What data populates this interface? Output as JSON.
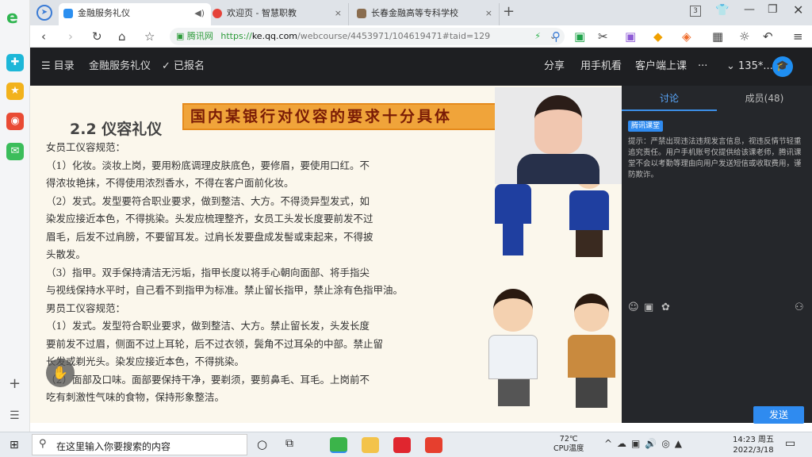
{
  "tabs": [
    {
      "title": "金融服务礼仪",
      "close": "◀)"
    },
    {
      "title": "欢迎页 - 智慧职教",
      "close": "×"
    },
    {
      "title": "长春金融高等专科学校",
      "close": "×"
    }
  ],
  "window": {
    "tabcount": "3"
  },
  "address": {
    "site_label": "腾讯网",
    "url_prefix": "https://",
    "url_domain": "ke.qq.com",
    "url_path": "/webcourse/4453971/104619471#taid=129"
  },
  "header": {
    "menu_label": "目录",
    "course_title": "金融服务礼仪",
    "enrolled_label": "已报名",
    "share": "分享",
    "mobile": "用手机看",
    "client": "客户端上课",
    "more": "···",
    "user": "135*..."
  },
  "slide": {
    "section_title": "2.2 仪容礼仪",
    "banner": "国内某银行对仪容的要求十分具体",
    "lines": [
      "  女员工仪容规范：",
      "（1）化妆。淡妆上岗，要用粉底调理皮肤底色，要修眉，要使用口红。不",
      "得浓妆艳抹，不得使用浓烈香水，不得在客户面前化妆。",
      "（2）发式。发型要符合职业要求，做到整洁、大方。不得烫异型发式，如",
      "染发应接近本色，不得挑染。头发应梳理整齐，女员工头发长度要前发不过",
      "眉毛，后发不过肩膀，不要留耳发。过肩长发要盘成发髻或束起来，不得披",
      "头散发。",
      "（3）指甲。双手保持清洁无污垢，指甲长度以将手心朝向面部、将手指尖",
      "与视线保持水平时，自己看不到指甲为标准。禁止留长指甲，禁止涂有色指甲油。",
      "  男员工仪容规范：",
      "（1）发式。发型符合职业要求，做到整洁、大方。禁止留长发，头发长度",
      "要前发不过眉，侧面不过上耳轮，后不过衣领，鬓角不过耳朵的中部。禁止留",
      "长发或剃光头。染发应接近本色，不得挑染。",
      "（2）面部及口味。面部要保持干净，要剃须，要剪鼻毛、耳毛。上岗前不",
      "吃有刺激性气味的食物，保持形象整洁。"
    ]
  },
  "panel": {
    "tab_discuss": "讨论",
    "tab_members": "成员(48)",
    "badge": "腾讯课堂",
    "notice": "提示：严禁出现违法违规发言信息，视违反情节轻重追究责任。用户手机账号仅提供给该课老师，腾讯课堂不会以考勤等理由向用户发送短信或收取费用，谨防欺诈。",
    "send": "发送"
  },
  "taskbar": {
    "search_placeholder": "在这里输入你要搜索的内容",
    "temp": "72℃",
    "temp_label": "CPU温度",
    "time": "14:23 周五",
    "date": "2022/3/18"
  }
}
